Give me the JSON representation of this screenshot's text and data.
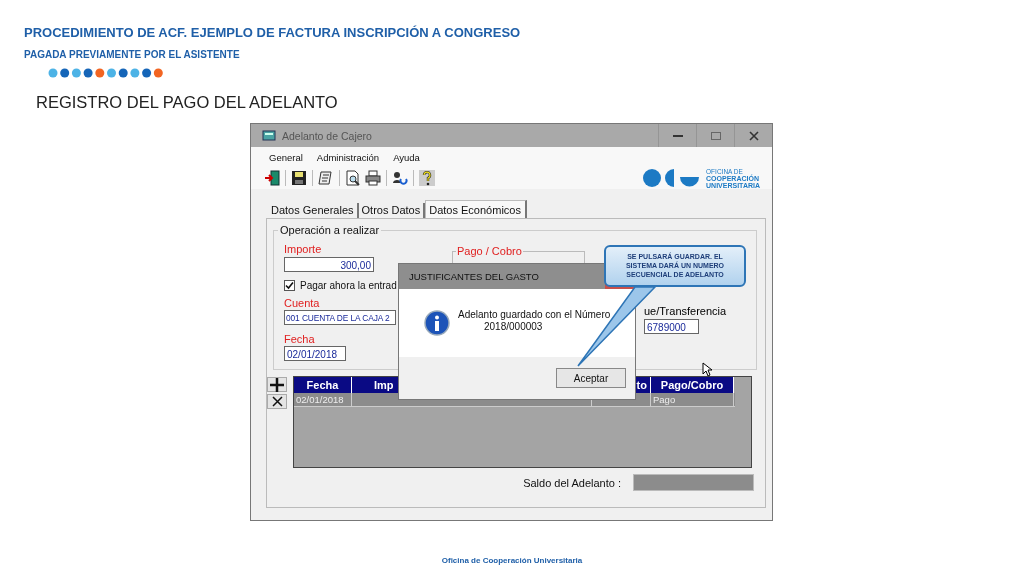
{
  "slide": {
    "title": "PROCEDIMIENTO DE ACF. EJEMPLO DE FACTURA INSCRIPCIÓN A CONGRESO",
    "subtitle": "PAGADA PREVIAMENTE POR EL ASISTENTE",
    "heading": "REGISTRO DEL PAGO DEL ADELANTO",
    "footer": "Oficina de Cooperación Universitaria"
  },
  "window": {
    "title": "Adelanto de Cajero"
  },
  "menu": [
    "General",
    "Administración",
    "Ayuda"
  ],
  "toolbar": [
    {
      "kind": "exit"
    },
    {
      "kind": "save"
    },
    {
      "kind": "notes"
    },
    {
      "kind": "preview"
    },
    {
      "kind": "print"
    },
    {
      "kind": "users"
    },
    {
      "kind": "help"
    }
  ],
  "logo": {
    "lines": [
      "OFICINA DE",
      "COOPERACIÓN",
      "UNIVERSITARIA"
    ]
  },
  "tabs": [
    {
      "label": "Datos Generales",
      "selected": false
    },
    {
      "label": "Otros Datos",
      "selected": false
    },
    {
      "label": "Datos Económicos",
      "selected": true
    }
  ],
  "operation": {
    "title": "Operación a realizar",
    "importe_label": "Importe",
    "importe": "300,00",
    "pay_now": {
      "label": "Pagar ahora la entrad",
      "checked": true
    },
    "cuenta_label": "Cuenta",
    "cuenta": "001 CUENTA DE LA CAJA 2",
    "fecha_label": "Fecha",
    "fecha": "02/01/2018",
    "pago_cobro_title": "Pago / Cobro",
    "transfer_label": "ue/Transferencia",
    "transfer": "6789000"
  },
  "table": {
    "columns": [
      "Fecha",
      "Imp",
      "to",
      "Pago/Cobro"
    ],
    "rows": [
      {
        "cells": [
          "02/01/2018",
          "",
          "",
          "Pago"
        ],
        "selected": true
      }
    ]
  },
  "saldo": {
    "label": "Saldo del Adelanto :"
  },
  "dialog": {
    "title": "JUSTIFICANTES DEL GASTO",
    "message": "Adelanto guardado con el Número",
    "number": "2018/000003",
    "button": "Aceptar"
  },
  "callout": {
    "text": "SE PULSARÁ GUARDAR. EL SISTEMA DARÁ UN NUMERO SECUENCIAL DE ADELANTO"
  }
}
